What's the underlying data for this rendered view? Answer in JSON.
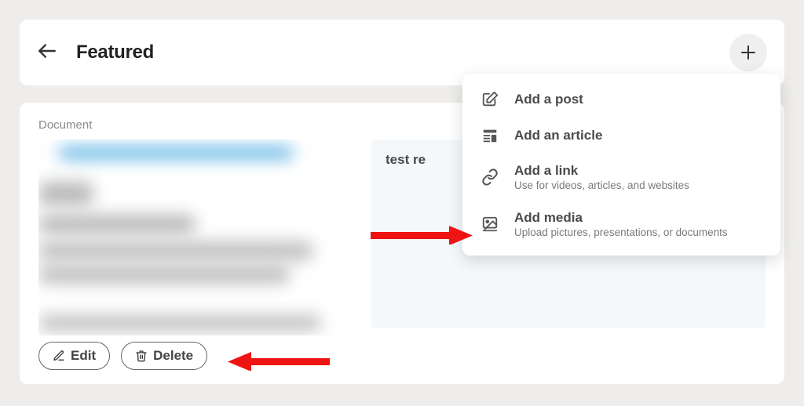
{
  "header": {
    "title": "Featured"
  },
  "document": {
    "label": "Document",
    "preview_title": "test re"
  },
  "actions": {
    "edit_label": "Edit",
    "delete_label": "Delete"
  },
  "dropdown": {
    "items": [
      {
        "title": "Add a post",
        "sub": ""
      },
      {
        "title": "Add an article",
        "sub": ""
      },
      {
        "title": "Add a link",
        "sub": "Use for videos, articles, and websites"
      },
      {
        "title": "Add media",
        "sub": "Upload pictures, presentations, or documents"
      }
    ]
  }
}
